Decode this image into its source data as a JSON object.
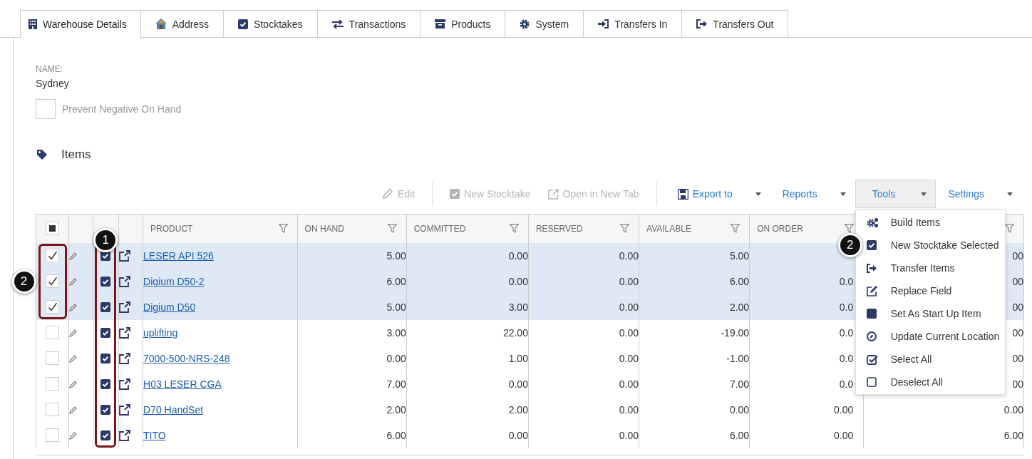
{
  "tabs": [
    {
      "label": "Warehouse Details",
      "selected": true
    },
    {
      "label": "Address",
      "selected": false
    },
    {
      "label": "Stocktakes",
      "selected": false
    },
    {
      "label": "Transactions",
      "selected": false
    },
    {
      "label": "Products",
      "selected": false
    },
    {
      "label": "System",
      "selected": false
    },
    {
      "label": "Transfers In",
      "selected": false
    },
    {
      "label": "Transfers Out",
      "selected": false
    }
  ],
  "details": {
    "name_label": "NAME:",
    "name_value": "Sydney",
    "prevent_negative": {
      "label": "Prevent Negative On Hand",
      "checked": false
    }
  },
  "items_section": {
    "title": "Items"
  },
  "toolbar": [
    {
      "kind": "action",
      "label": "Edit",
      "disabled": true
    },
    {
      "kind": "separator"
    },
    {
      "kind": "action",
      "label": "New Stocktake",
      "disabled": true
    },
    {
      "kind": "action",
      "label": "Open in New Tab",
      "disabled": true
    },
    {
      "kind": "separator"
    },
    {
      "kind": "dropdown",
      "label": "Export to",
      "open": false
    },
    {
      "kind": "dropdown",
      "label": "Reports",
      "open": false
    },
    {
      "kind": "dropdown",
      "label": "Tools",
      "open": true
    },
    {
      "kind": "dropdown",
      "label": "Settings",
      "open": false
    }
  ],
  "tools_menu": [
    {
      "label": "Build Items"
    },
    {
      "label": "New Stocktake Selected",
      "callout": "2"
    },
    {
      "label": "Transfer Items"
    },
    {
      "label": "Replace Field"
    },
    {
      "label": "Set As Start Up Item"
    },
    {
      "label": "Update Current Location"
    },
    {
      "label": "Select All"
    },
    {
      "label": "Deselect All"
    }
  ],
  "table": {
    "select_all": {
      "indeterminate": true
    },
    "columns": [
      {
        "label": "PRODUCT"
      },
      {
        "label": "ON HAND"
      },
      {
        "label": "COMMITTED"
      },
      {
        "label": "RESERVED"
      },
      {
        "label": "AVAILABLE"
      },
      {
        "label": "ON ORDER"
      },
      {}
    ],
    "rows": [
      {
        "selected": true,
        "flagged": true,
        "product": "LESER API 526",
        "on_hand": "5.00",
        "committed": "0.00",
        "reserved": "0.00",
        "available": "5.00",
        "column_8": "00"
      },
      {
        "selected": true,
        "flagged": true,
        "product": "Digium D50-2",
        "on_hand": "6.00",
        "committed": "0.00",
        "reserved": "0.00",
        "available": "6.00",
        "on_order": "0.0",
        "column_8": "00"
      },
      {
        "selected": true,
        "flagged": true,
        "product": "Digium D50",
        "on_hand": "5.00",
        "committed": "3.00",
        "reserved": "0.00",
        "available": "2.00",
        "on_order": "0.0",
        "column_8": "00"
      },
      {
        "selected": false,
        "flagged": true,
        "product": "uplifting",
        "on_hand": "3.00",
        "committed": "22.00",
        "reserved": "0.00",
        "available": "-19.00",
        "on_order": "0.0",
        "column_8": "00"
      },
      {
        "selected": false,
        "flagged": true,
        "product": "7000-500-NRS-248",
        "on_hand": "0.00",
        "committed": "1.00",
        "reserved": "0.00",
        "available": "-1.00",
        "on_order": "0.0",
        "column_8": "00"
      },
      {
        "selected": false,
        "flagged": true,
        "product": "H03 LESER CGA",
        "on_hand": "7.00",
        "committed": "0.00",
        "reserved": "0.00",
        "available": "7.00",
        "on_order": "0.0",
        "column_8": "00"
      },
      {
        "selected": false,
        "flagged": true,
        "product": "D70 HandSet",
        "on_hand": "2.00",
        "committed": "2.00",
        "reserved": "0.00",
        "available": "0.00",
        "on_order": "0.00",
        "column_8": "0.00"
      },
      {
        "selected": false,
        "flagged": true,
        "product": "TITO",
        "on_hand": "6.00",
        "committed": "0.00",
        "reserved": "0.00",
        "available": "6.00",
        "on_order": "0.00",
        "column_8": "6.00"
      }
    ]
  },
  "annotations": [
    {
      "kind": "flag-column",
      "number": "1"
    },
    {
      "kind": "selection",
      "number": "2"
    }
  ]
}
